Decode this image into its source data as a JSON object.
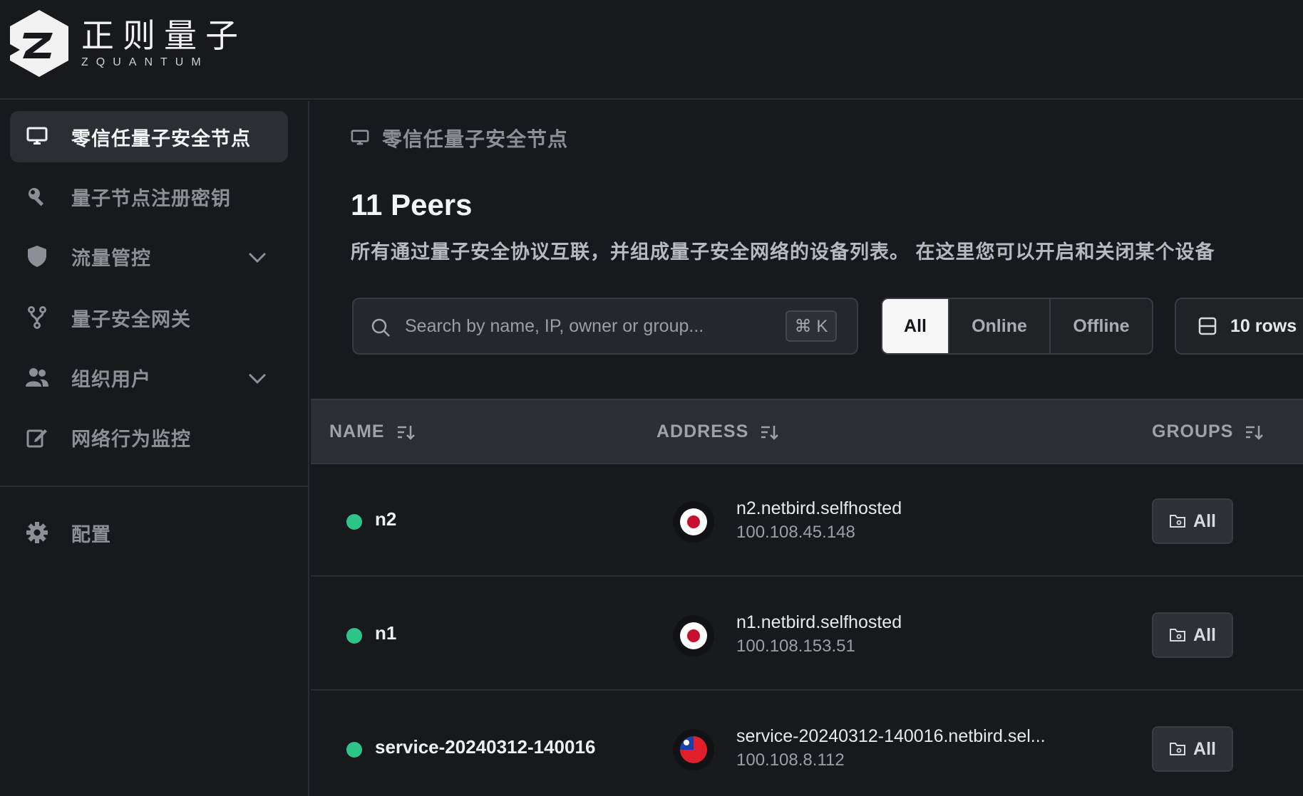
{
  "brand": {
    "name_cn": "正则量子",
    "name_en": "ZQUANTUM"
  },
  "sidebar": {
    "items": [
      {
        "label": "零信任量子安全节点",
        "icon": "monitor-icon",
        "active": true
      },
      {
        "label": "量子节点注册密钥",
        "icon": "key-icon"
      },
      {
        "label": "流量管控",
        "icon": "shield-icon",
        "expandable": true
      },
      {
        "label": "量子安全网关",
        "icon": "fork-icon"
      },
      {
        "label": "组织用户",
        "icon": "users-icon",
        "expandable": true
      },
      {
        "label": "网络行为监控",
        "icon": "edit-icon"
      }
    ],
    "bottom_items": [
      {
        "label": "配置",
        "icon": "gear-icon"
      }
    ]
  },
  "main": {
    "breadcrumb": "零信任量子安全节点",
    "title": "11 Peers",
    "description": "所有通过量子安全协议互联，并组成量子安全网络的设备列表。 在这里您可以开启和关闭某个设备",
    "search": {
      "placeholder": "Search by name, IP, owner or group...",
      "shortcut": "⌘ K"
    },
    "filters": {
      "all": "All",
      "online": "Online",
      "offline": "Offline",
      "selected": "All"
    },
    "rows_per_page": "10 rows"
  },
  "table": {
    "columns": [
      "NAME",
      "ADDRESS",
      "GROUPS"
    ],
    "rows": [
      {
        "name": "n2",
        "status": "online",
        "host": "n2.netbird.selfhosted",
        "ip": "100.108.45.148",
        "flag": "japan-flag-icon",
        "group": "All"
      },
      {
        "name": "n1",
        "status": "online",
        "host": "n1.netbird.selfhosted",
        "ip": "100.108.153.51",
        "flag": "japan-flag-icon",
        "group": "All"
      },
      {
        "name": "service-20240312-140016",
        "status": "online",
        "host": "service-20240312-140016.netbird.sel...",
        "ip": "100.108.8.112",
        "flag": "taiwan-flag-icon",
        "group": "All"
      }
    ]
  },
  "colors": {
    "background": "#18191d",
    "online": "#2cc58a",
    "active_nav": "#2c2e33"
  }
}
